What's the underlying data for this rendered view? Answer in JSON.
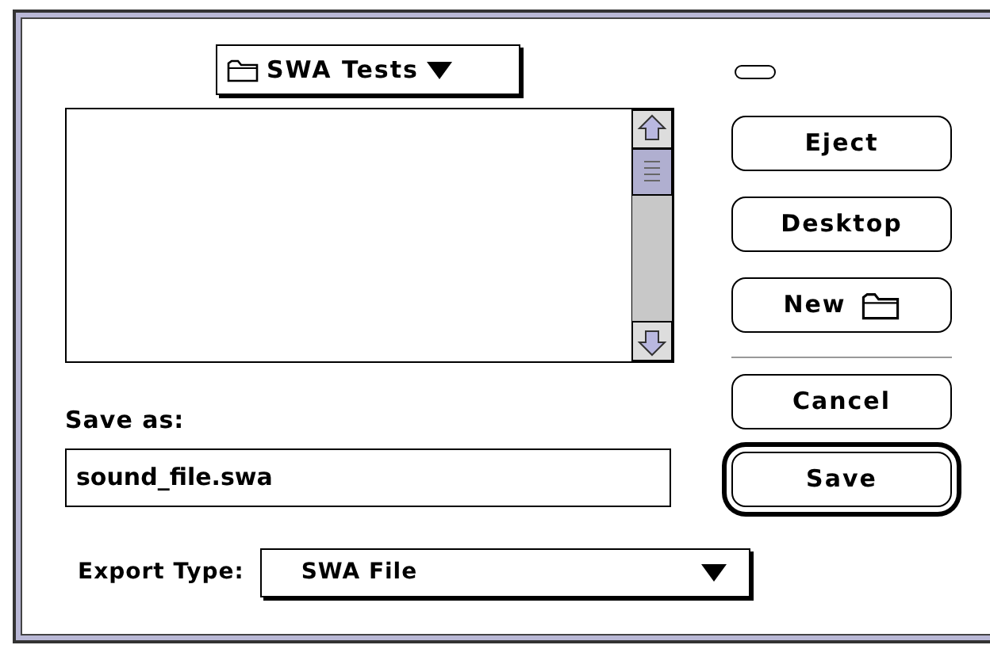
{
  "folder_popup": {
    "label": "SWA Tests"
  },
  "top_buttons": [
    {
      "label": "Eject",
      "kind": "plain",
      "default": false
    },
    {
      "label": "Desktop",
      "kind": "plain",
      "default": false
    },
    {
      "label": "New",
      "kind": "new_folder",
      "default": false
    }
  ],
  "bottom_buttons": [
    {
      "label": "Cancel",
      "default": false
    },
    {
      "label": "Save",
      "default": true
    }
  ],
  "save_as": {
    "label": "Save as:",
    "value": "sound_file.swa"
  },
  "export_type": {
    "label": "Export Type:",
    "value": "SWA File"
  }
}
